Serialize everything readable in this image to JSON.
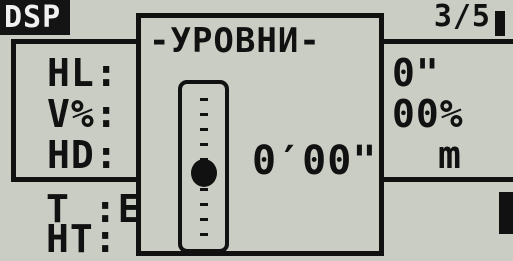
{
  "background": {
    "mode_tab": "DSP",
    "page_counter": "3/5",
    "rows": [
      {
        "label": "HL:",
        "value": "0\""
      },
      {
        "label": "V%:",
        "value": "00%"
      },
      {
        "label": "HD:",
        "value": "m"
      }
    ],
    "bottom": {
      "t_label": "T :E",
      "ht_label": "HT:"
    }
  },
  "popup": {
    "title": "-УРОВНИ-",
    "angle": "0′00\""
  }
}
